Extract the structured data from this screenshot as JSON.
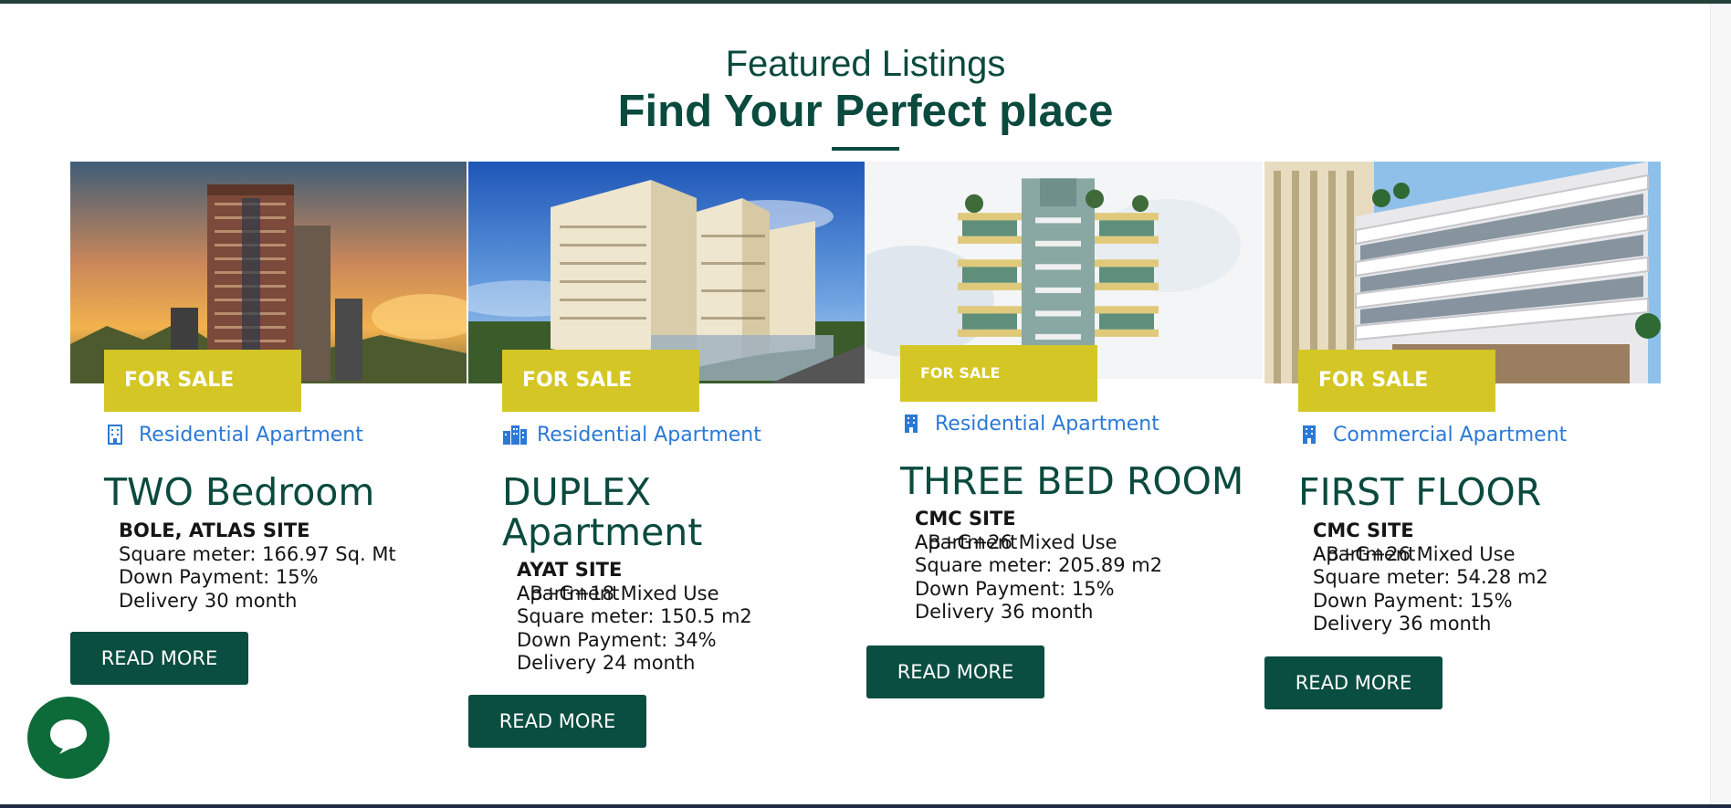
{
  "section": {
    "eyebrow": "Featured Listings",
    "title": "Find Your Perfect place"
  },
  "colors": {
    "brand_green": "#0b4a3e",
    "tag_yellow": "#d4c624",
    "link_blue": "#2b79d7",
    "chat_green": "#0d6b3a"
  },
  "listings": [
    {
      "tag": "FOR SALE",
      "category": "Residential Apartment",
      "category_icon": "building-icon",
      "name": "TWO Bedroom",
      "site": "BOLE, ATLAS SITE",
      "lines": [
        "Square meter: 166.97 Sq. Mt",
        "Down Payment: 15%",
        "Delivery 30 month"
      ],
      "button": "READ MORE"
    },
    {
      "tag": "FOR SALE",
      "category": "Residential Apartment",
      "category_icon": "city-icon",
      "name": "DUPLEX Apartment",
      "site": "AYAT SITE",
      "overlap_a": "AB+G+18 Mixed Use",
      "overlap_b": "Apartment",
      "lines": [
        "Square meter: 150.5 m2",
        "Down Payment: 34%",
        "Delivery 24 month"
      ],
      "button": "READ MORE"
    },
    {
      "tag": "FOR SALE",
      "category": "Residential Apartment",
      "category_icon": "building-icon",
      "name": "THREE BED ROOM",
      "site": "CMC SITE",
      "overlap_a": "AB+G+26 Mixed Use",
      "overlap_b": "Apartment",
      "lines": [
        "Square meter: 205.89 m2",
        "Down Payment: 15%",
        "Delivery 36 month"
      ],
      "button": "READ MORE"
    },
    {
      "tag": "FOR SALE",
      "category": "Commercial Apartment",
      "category_icon": "building-icon",
      "name": "FIRST FLOOR",
      "site": "CMC SITE",
      "overlap_a": "AB+G+26 Mixed Use",
      "overlap_b": "Apartment",
      "lines": [
        "Square meter: 54.28 m2",
        "Down Payment: 15%",
        "Delivery 36 month"
      ],
      "button": "READ MORE"
    }
  ],
  "chat": {
    "icon": "chat-bubble-icon"
  }
}
